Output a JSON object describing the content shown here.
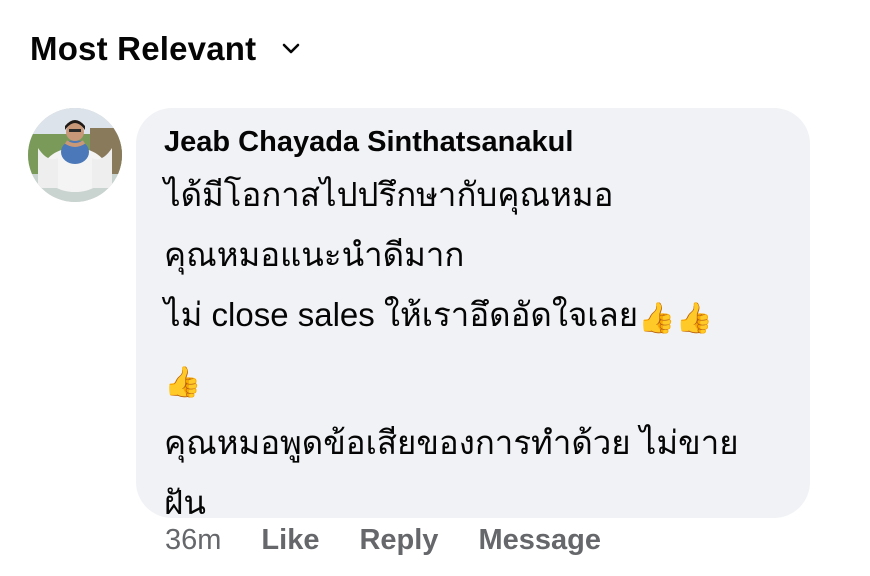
{
  "sort": {
    "label": "Most Relevant"
  },
  "comment": {
    "author": "Jeab Chayada Sinthatsanakul",
    "lines": [
      "ได้มีโอกาสไปปรึกษากับคุณหมอ",
      "คุณหมอแนะนำดีมาก",
      "ไม่ close sales ให้เราอึดอัดใจเลย",
      "",
      "คุณหมอพูดข้อเสียของการทำด้วย ไม่ขาย",
      "ฝัน"
    ],
    "emoji": "👍",
    "timestamp": "36m",
    "actions": {
      "like": "Like",
      "reply": "Reply",
      "message": "Message"
    }
  },
  "colors": {
    "bubble": "#f0f2f5",
    "secondary_text": "#65676b",
    "thumb": "#f5b40c"
  }
}
